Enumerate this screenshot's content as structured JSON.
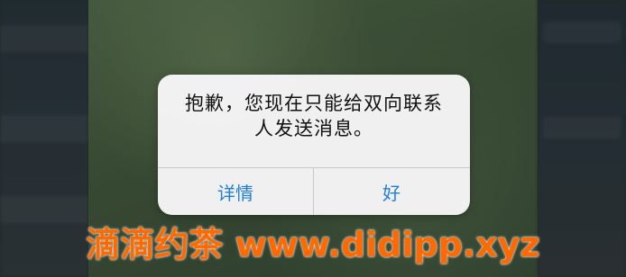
{
  "alert": {
    "message_line1": "抱歉，您现在只能给双向联系",
    "message_line2": "人发送消息。",
    "details_button": "详情",
    "ok_button": "好",
    "button_color": "#1e7fe0"
  },
  "watermark": {
    "text": "滴滴约茶 www.didipp.xyz",
    "color": "#ff6a00"
  }
}
